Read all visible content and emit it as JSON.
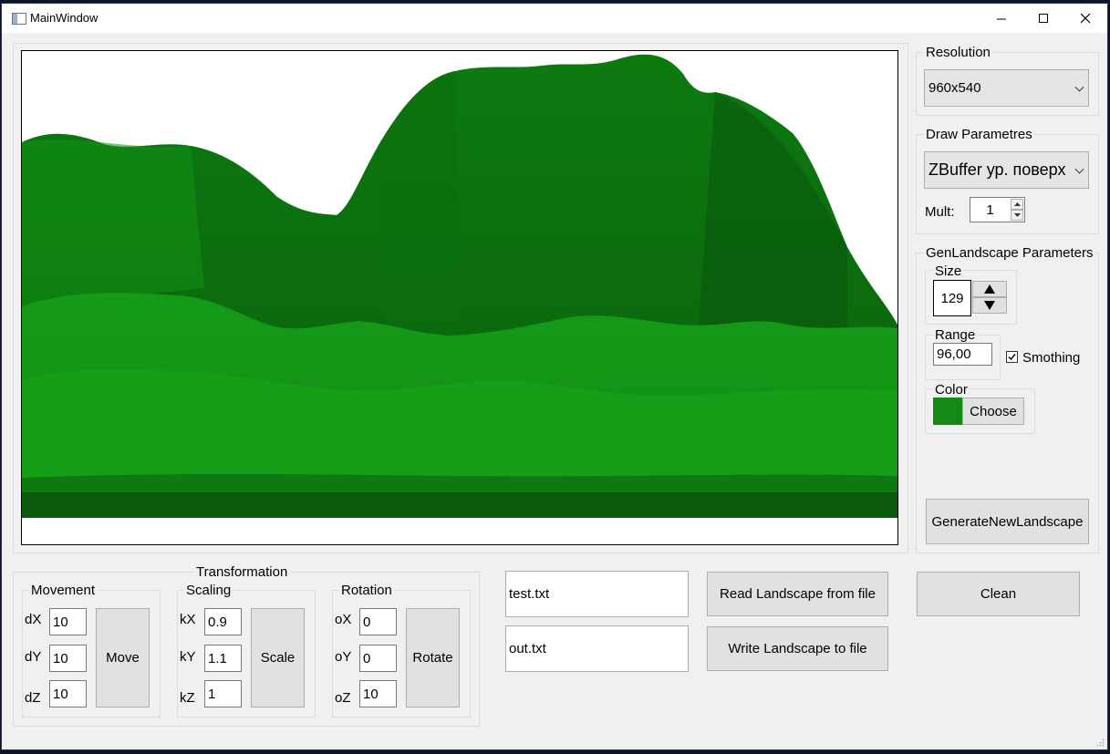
{
  "window": {
    "title": "MainWindow",
    "minimize": "—",
    "maximize": "☐",
    "close": "✕"
  },
  "resolution": {
    "label": "Resolution",
    "value": "960x540"
  },
  "draw": {
    "label": "Draw Parametres",
    "mode": "ZBuffer ур. поверх",
    "mult_label": "Mult:",
    "mult_value": "1"
  },
  "gen": {
    "label": "GenLandscape Parameters",
    "size_label": "Size",
    "size_value": "129",
    "range_label": "Range",
    "range_value": "96,00",
    "smoothing_label": "Smothing",
    "smoothing_checked": true,
    "color_label": "Color",
    "color_value": "#128a14",
    "choose_label": "Choose",
    "generate_label": "GenerateNewLandscape"
  },
  "transform": {
    "label": "Transformation",
    "movement": {
      "label": "Movement",
      "dx_label": "dX",
      "dx": "10",
      "dy_label": "dY",
      "dy": "10",
      "dz_label": "dZ",
      "dz": "10",
      "button": "Move"
    },
    "scaling": {
      "label": "Scaling",
      "kx_label": "kX",
      "kx": "0.9",
      "ky_label": "kY",
      "ky": "1.1",
      "kz_label": "kZ",
      "kz": "1",
      "button": "Scale"
    },
    "rotation": {
      "label": "Rotation",
      "ox_label": "oX",
      "ox": "0",
      "oy_label": "oY",
      "oy": "0",
      "oz_label": "oZ",
      "oz": "10",
      "button": "Rotate"
    }
  },
  "files": {
    "input_file": "test.txt",
    "output_file": "out.txt",
    "read_label": "Read Landscape from file",
    "write_label": "Write Landscape to file"
  },
  "clean_label": "Clean"
}
